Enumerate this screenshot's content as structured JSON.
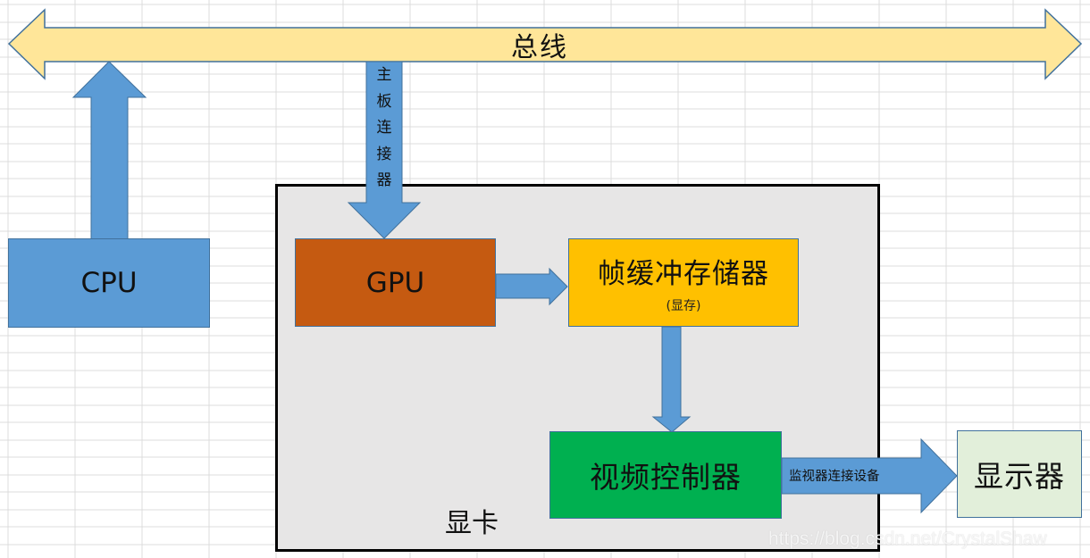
{
  "diagram": {
    "bus": {
      "label": "总线"
    },
    "cpu": {
      "label": "CPU"
    },
    "motherboard_connector": {
      "label": "主板连接器",
      "chars": [
        "主",
        "板",
        "连",
        "接",
        "器"
      ]
    },
    "graphics_card": {
      "label": "显卡"
    },
    "gpu": {
      "label": "GPU"
    },
    "frame_buffer": {
      "label": "帧缓冲存储器",
      "sublabel": "(显存)"
    },
    "video_controller": {
      "label": "视频控制器"
    },
    "monitor_connector": {
      "label": "监视器连接设备"
    },
    "monitor": {
      "label": "显示器"
    },
    "watermark": "https://blog.csdn.net/CrystalShaw",
    "colors": {
      "bus_fill": "#ffe699",
      "arrow_fill": "#5b9bd5",
      "outline": "#41719c",
      "cpu_fill": "#5b9bd5",
      "card_fill": "#e7e6e6",
      "gpu_fill": "#c55a11",
      "frame_buffer_fill": "#ffc000",
      "video_controller_fill": "#00b050",
      "monitor_fill": "#e2efda"
    }
  }
}
